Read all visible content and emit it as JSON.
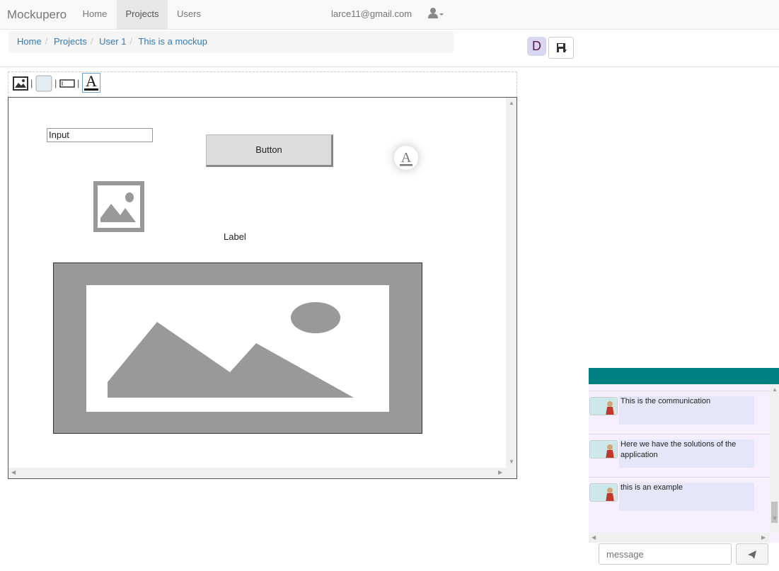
{
  "navbar": {
    "brand": "Mockupero",
    "items": [
      {
        "label": "Home"
      },
      {
        "label": "Projects",
        "active": true
      },
      {
        "label": "Users"
      }
    ],
    "email": "larce11@gmail.com",
    "user_icon": "user-icon"
  },
  "breadcrumb": [
    "Home",
    "Projects",
    "User 1",
    "This is a mockup"
  ],
  "actions": {
    "avatar_letter": "D",
    "save_icon": "save-icon"
  },
  "toolbar": {
    "tools": [
      "image-tool-icon",
      "button-tool-icon",
      "input-tool-icon",
      "text-tool-icon"
    ]
  },
  "canvas": {
    "input_value": "Input",
    "button_label": "Button",
    "label_text": "Label"
  },
  "chat": {
    "header_color": "#008080",
    "messages": [
      {
        "text": "This is the communication"
      },
      {
        "text": "Here we have the solutions of the application"
      },
      {
        "text": "this is an example"
      }
    ],
    "input_placeholder": "message",
    "send_icon": "send-icon"
  }
}
